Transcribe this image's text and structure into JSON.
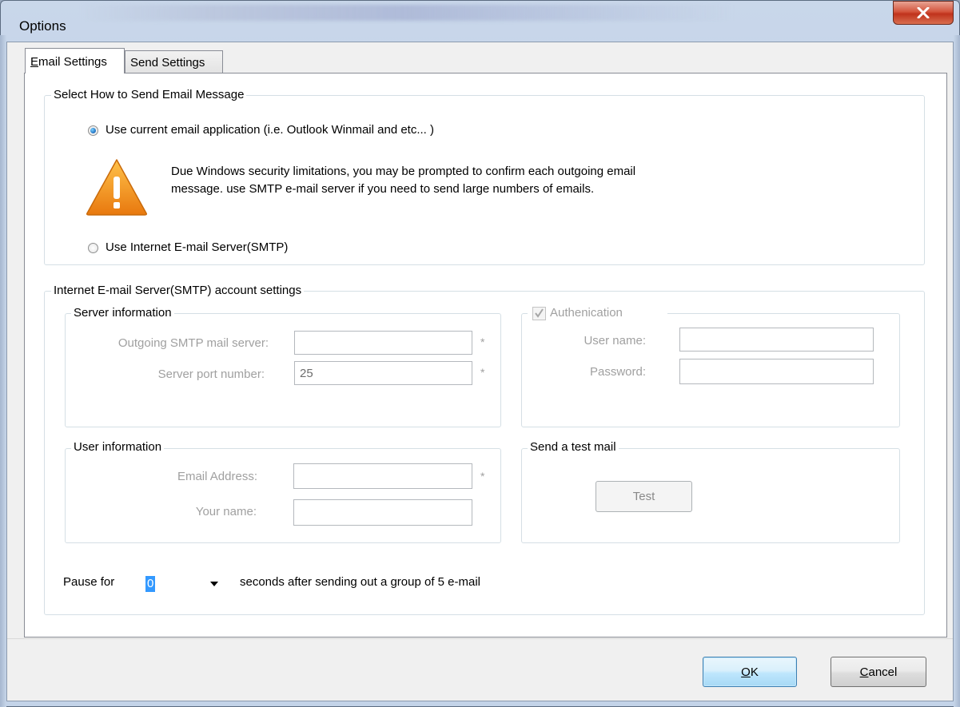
{
  "window": {
    "title": "Options",
    "close_label": "X"
  },
  "tabs": [
    {
      "label": "Email Settings",
      "accel": "E",
      "rest": "mail Settings",
      "active": true
    },
    {
      "label": "Send Settings",
      "active": false
    }
  ],
  "send_method": {
    "group_label": "Select How to Send Email Message",
    "option_current_app": "Use current email application (i.e. Outlook Winmail and etc... )",
    "option_current_app_selected": true,
    "warning_line1": "Due Windows security limitations,  you may be prompted to confirm each outgoing email",
    "warning_line2": "message. use SMTP e-mail server if you need to send large numbers of emails.",
    "option_smtp": "Use Internet E-mail Server(SMTP)",
    "option_smtp_selected": false
  },
  "smtp_settings": {
    "group_label": "Internet E-mail Server(SMTP) account settings",
    "server_info": {
      "group_label": "Server information",
      "outgoing_server_label": "Outgoing SMTP mail server:",
      "outgoing_server_value": "",
      "port_label": "Server port number:",
      "port_value": "25",
      "required_mark": "*"
    },
    "auth": {
      "checkbox_label": "Authenication",
      "checked": true,
      "username_label": "User name:",
      "username_value": "",
      "password_label": "Password:",
      "password_value": ""
    },
    "user_info": {
      "group_label": "User information",
      "email_label": "Email Address:",
      "email_value": "",
      "name_label": "Your name:",
      "name_value": "",
      "required_mark": "*"
    },
    "test_mail": {
      "group_label": "Send a test mail",
      "button_label": "Test"
    },
    "pause": {
      "prefix": "Pause for",
      "value": "0",
      "suffix": "seconds after sending out a group of 5 e-mail"
    }
  },
  "footer": {
    "ok_label": "OK",
    "ok_accel": "O",
    "ok_rest": "K",
    "cancel_label": "Cancel",
    "cancel_accel": "C",
    "cancel_rest": "ancel"
  },
  "colors": {
    "accent": "#3399ff",
    "close_button": "#c7452d",
    "warning": "#f29a1f"
  },
  "icons": [
    "close-icon",
    "warning-icon",
    "dropdown-arrow-icon",
    "checkmark-icon"
  ]
}
